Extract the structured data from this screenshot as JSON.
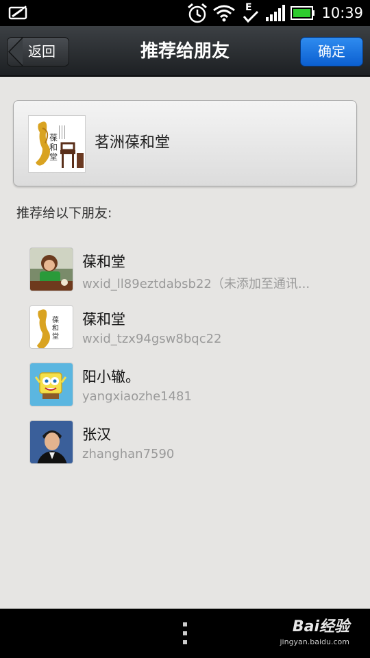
{
  "status_bar": {
    "time": "10:39",
    "icons": [
      "unlock-icon",
      "alarm-icon",
      "wifi-icon",
      "edge-signal-icon",
      "signal-bars-icon",
      "battery-icon"
    ]
  },
  "header": {
    "back_label": "返回",
    "title": "推荐给朋友",
    "confirm_label": "确定",
    "confirm_color": "#1a73e2"
  },
  "card": {
    "name": "茗洲葆和堂"
  },
  "section_label": "推荐给以下朋友:",
  "contacts": [
    {
      "name": "葆和堂",
      "id": "wxid_ll89eztdabsb22（未添加至通讯..."
    },
    {
      "name": "葆和堂",
      "id": "wxid_tzx94gsw8bqc22"
    },
    {
      "name": "阳小辙。",
      "id": "yangxiaozhe1481"
    },
    {
      "name": "张汉",
      "id": "zhanghan7590"
    }
  ],
  "nav_bar": {
    "watermark_main": "Bai经验",
    "watermark_sub": "jingyan.baidu.com"
  }
}
